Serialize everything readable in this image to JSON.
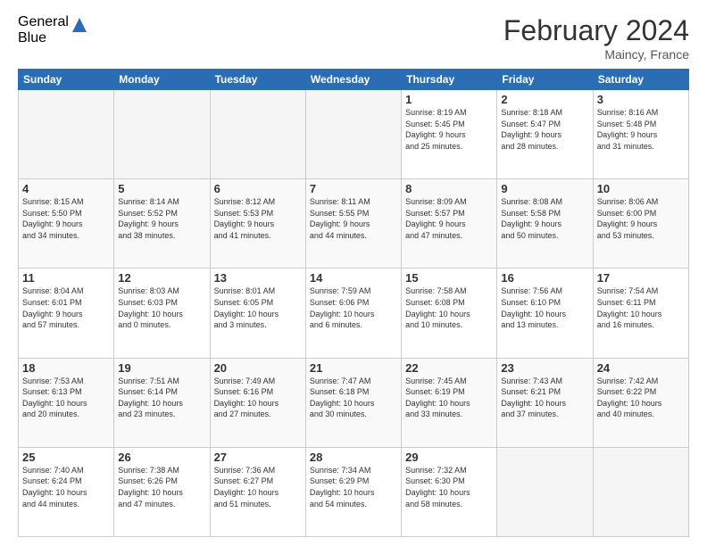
{
  "logo": {
    "general": "General",
    "blue": "Blue"
  },
  "title": "February 2024",
  "location": "Maincy, France",
  "headers": [
    "Sunday",
    "Monday",
    "Tuesday",
    "Wednesday",
    "Thursday",
    "Friday",
    "Saturday"
  ],
  "weeks": [
    [
      {
        "day": "",
        "info": ""
      },
      {
        "day": "",
        "info": ""
      },
      {
        "day": "",
        "info": ""
      },
      {
        "day": "",
        "info": ""
      },
      {
        "day": "1",
        "info": "Sunrise: 8:19 AM\nSunset: 5:45 PM\nDaylight: 9 hours\nand 25 minutes."
      },
      {
        "day": "2",
        "info": "Sunrise: 8:18 AM\nSunset: 5:47 PM\nDaylight: 9 hours\nand 28 minutes."
      },
      {
        "day": "3",
        "info": "Sunrise: 8:16 AM\nSunset: 5:48 PM\nDaylight: 9 hours\nand 31 minutes."
      }
    ],
    [
      {
        "day": "4",
        "info": "Sunrise: 8:15 AM\nSunset: 5:50 PM\nDaylight: 9 hours\nand 34 minutes."
      },
      {
        "day": "5",
        "info": "Sunrise: 8:14 AM\nSunset: 5:52 PM\nDaylight: 9 hours\nand 38 minutes."
      },
      {
        "day": "6",
        "info": "Sunrise: 8:12 AM\nSunset: 5:53 PM\nDaylight: 9 hours\nand 41 minutes."
      },
      {
        "day": "7",
        "info": "Sunrise: 8:11 AM\nSunset: 5:55 PM\nDaylight: 9 hours\nand 44 minutes."
      },
      {
        "day": "8",
        "info": "Sunrise: 8:09 AM\nSunset: 5:57 PM\nDaylight: 9 hours\nand 47 minutes."
      },
      {
        "day": "9",
        "info": "Sunrise: 8:08 AM\nSunset: 5:58 PM\nDaylight: 9 hours\nand 50 minutes."
      },
      {
        "day": "10",
        "info": "Sunrise: 8:06 AM\nSunset: 6:00 PM\nDaylight: 9 hours\nand 53 minutes."
      }
    ],
    [
      {
        "day": "11",
        "info": "Sunrise: 8:04 AM\nSunset: 6:01 PM\nDaylight: 9 hours\nand 57 minutes."
      },
      {
        "day": "12",
        "info": "Sunrise: 8:03 AM\nSunset: 6:03 PM\nDaylight: 10 hours\nand 0 minutes."
      },
      {
        "day": "13",
        "info": "Sunrise: 8:01 AM\nSunset: 6:05 PM\nDaylight: 10 hours\nand 3 minutes."
      },
      {
        "day": "14",
        "info": "Sunrise: 7:59 AM\nSunset: 6:06 PM\nDaylight: 10 hours\nand 6 minutes."
      },
      {
        "day": "15",
        "info": "Sunrise: 7:58 AM\nSunset: 6:08 PM\nDaylight: 10 hours\nand 10 minutes."
      },
      {
        "day": "16",
        "info": "Sunrise: 7:56 AM\nSunset: 6:10 PM\nDaylight: 10 hours\nand 13 minutes."
      },
      {
        "day": "17",
        "info": "Sunrise: 7:54 AM\nSunset: 6:11 PM\nDaylight: 10 hours\nand 16 minutes."
      }
    ],
    [
      {
        "day": "18",
        "info": "Sunrise: 7:53 AM\nSunset: 6:13 PM\nDaylight: 10 hours\nand 20 minutes."
      },
      {
        "day": "19",
        "info": "Sunrise: 7:51 AM\nSunset: 6:14 PM\nDaylight: 10 hours\nand 23 minutes."
      },
      {
        "day": "20",
        "info": "Sunrise: 7:49 AM\nSunset: 6:16 PM\nDaylight: 10 hours\nand 27 minutes."
      },
      {
        "day": "21",
        "info": "Sunrise: 7:47 AM\nSunset: 6:18 PM\nDaylight: 10 hours\nand 30 minutes."
      },
      {
        "day": "22",
        "info": "Sunrise: 7:45 AM\nSunset: 6:19 PM\nDaylight: 10 hours\nand 33 minutes."
      },
      {
        "day": "23",
        "info": "Sunrise: 7:43 AM\nSunset: 6:21 PM\nDaylight: 10 hours\nand 37 minutes."
      },
      {
        "day": "24",
        "info": "Sunrise: 7:42 AM\nSunset: 6:22 PM\nDaylight: 10 hours\nand 40 minutes."
      }
    ],
    [
      {
        "day": "25",
        "info": "Sunrise: 7:40 AM\nSunset: 6:24 PM\nDaylight: 10 hours\nand 44 minutes."
      },
      {
        "day": "26",
        "info": "Sunrise: 7:38 AM\nSunset: 6:26 PM\nDaylight: 10 hours\nand 47 minutes."
      },
      {
        "day": "27",
        "info": "Sunrise: 7:36 AM\nSunset: 6:27 PM\nDaylight: 10 hours\nand 51 minutes."
      },
      {
        "day": "28",
        "info": "Sunrise: 7:34 AM\nSunset: 6:29 PM\nDaylight: 10 hours\nand 54 minutes."
      },
      {
        "day": "29",
        "info": "Sunrise: 7:32 AM\nSunset: 6:30 PM\nDaylight: 10 hours\nand 58 minutes."
      },
      {
        "day": "",
        "info": ""
      },
      {
        "day": "",
        "info": ""
      }
    ]
  ]
}
